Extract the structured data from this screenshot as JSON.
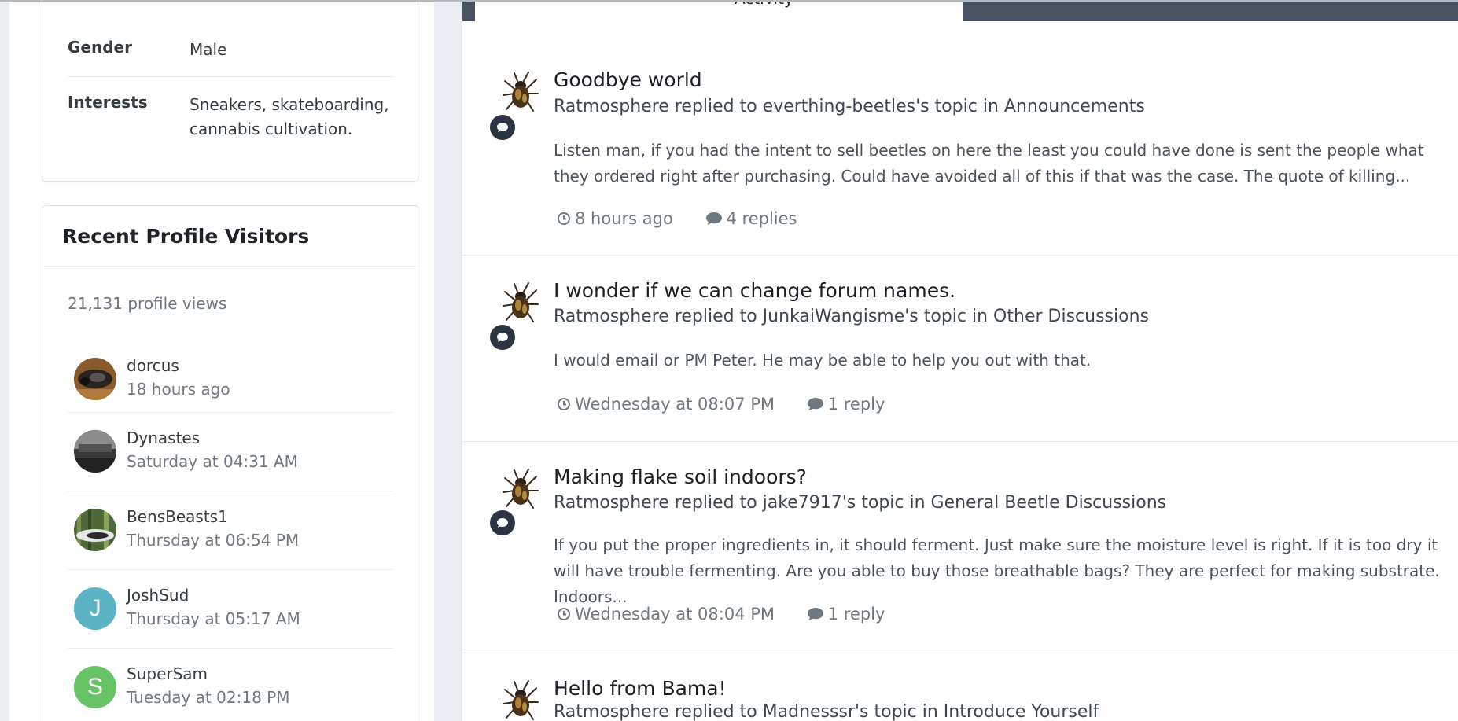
{
  "about": {
    "fields": [
      {
        "label": "Gender",
        "value": "Male"
      },
      {
        "label": "Interests",
        "value": "Sneakers, skateboarding, cannabis cultivation."
      }
    ]
  },
  "visitors": {
    "title": "Recent Profile Visitors",
    "views": "21,131 profile views",
    "items": [
      {
        "name": "dorcus",
        "time": "18 hours ago"
      },
      {
        "name": "Dynastes",
        "time": "Saturday at 04:31 AM"
      },
      {
        "name": "BensBeasts1",
        "time": "Thursday at 06:54 PM"
      },
      {
        "name": "JoshSud",
        "time": "Thursday at 05:17 AM",
        "letter": "J"
      },
      {
        "name": "SuperSam",
        "time": "Tuesday at 02:18 PM",
        "letter": "S"
      }
    ]
  },
  "feed": {
    "tab_label": "Activity",
    "items": [
      {
        "title": "Goodbye world",
        "meta": "Ratmosphere replied to everthing-beetles's topic in Announcements",
        "snippet": "Listen man, if you had the intent to sell beetles on here the least you could have done is sent the people what they ordered right after purchasing. Could have avoided all of this if that was the case. The quote of killing...",
        "time": "8 hours ago",
        "replies": "4 replies"
      },
      {
        "title": "I wonder if we can change forum names.",
        "meta": "Ratmosphere replied to JunkaiWangisme's topic in Other Discussions",
        "snippet": "I would email or PM Peter. He may be able to help you out with that.",
        "time": "Wednesday at 08:07 PM",
        "replies": "1 reply"
      },
      {
        "title": "Making flake soil indoors?",
        "meta": "Ratmosphere replied to jake7917's topic in General Beetle Discussions",
        "snippet": "If you put the proper ingredients in, it should ferment. Just make sure the moisture level is right. If it is too dry it will have trouble fermenting. Are you able to buy those breathable bags? They are perfect for making substrate. Indoors...",
        "time": "Wednesday at 08:04 PM",
        "replies": "1 reply"
      },
      {
        "title": "Hello from Bama!",
        "meta": "Ratmosphere replied to Madnesssr's topic in Introduce Yourself"
      }
    ]
  },
  "colors": {
    "badge": "#2c3441",
    "tab_dark": "#4a5361",
    "joshsud_avatar": "#5bb3c4",
    "supersam_avatar": "#66c466"
  }
}
